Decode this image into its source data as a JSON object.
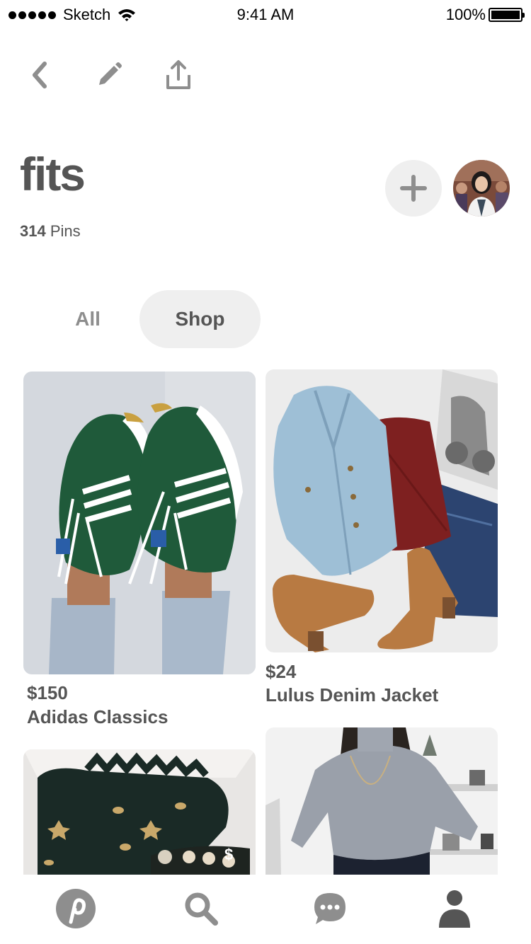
{
  "status_bar": {
    "carrier": "Sketch",
    "time": "9:41 AM",
    "battery": "100%"
  },
  "board": {
    "title": "fits",
    "pin_count": "314",
    "pin_label": "Pins"
  },
  "tabs": {
    "all_label": "All",
    "shop_label": "Shop",
    "selected": "Shop"
  },
  "pins": [
    {
      "price": "$150",
      "title": "Adidas Classics"
    },
    {
      "price": "$24",
      "title": "Lulus Denim Jacket"
    },
    {
      "price": "",
      "title": ""
    },
    {
      "price": "",
      "title": ""
    }
  ],
  "overlay_badge": "$",
  "icons": {
    "back": "chevron-left-icon",
    "edit": "pencil-icon",
    "share": "share-icon",
    "add": "plus-icon",
    "home": "pinterest-logo-icon",
    "search": "search-icon",
    "messages": "chat-bubble-icon",
    "profile": "person-icon"
  },
  "colors": {
    "text": "#555555",
    "muted": "#8e8e8e",
    "chip_bg": "#efefef",
    "icon": "#8e8e8e"
  }
}
